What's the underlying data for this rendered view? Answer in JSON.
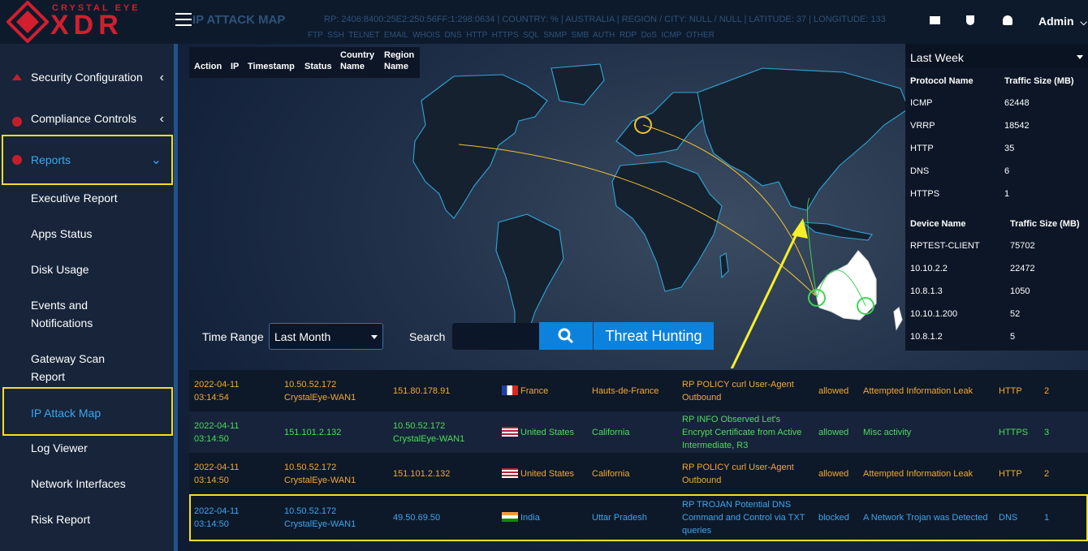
{
  "brand": {
    "name": "CRYSTAL EYE",
    "product": "XDR"
  },
  "header": {
    "title": "IP ATTACK MAP",
    "info": "RP: 2406:8400:25E2:250:56FF:1:298:0634 | COUNTRY: % | AUSTRALIA | REGION / CITY: NULL / NULL | LATITUDE: 37 | LONGITUDE: 133",
    "legend": "FTP  SSH  TELNET  EMAIL  WHOIS  DNS  HTTP  HTTPS  SQL  SNMP  SMB  AUTH  RDP  DoS  ICMP  OTHER",
    "admin": "Admin"
  },
  "sidebar": {
    "security": "Security Configuration",
    "compliance": "Compliance Controls",
    "reports": "Reports",
    "items": [
      "Executive Report",
      "Apps Status",
      "Disk Usage",
      "Events and Notifications",
      "Gateway Scan Report",
      "IP Attack Map",
      "Log Viewer",
      "Network Interfaces",
      "Risk Report"
    ]
  },
  "left_table": {
    "cols": [
      "Action",
      "IP",
      "Timestamp",
      "Status",
      "Country Name",
      "Region Name"
    ]
  },
  "controls": {
    "time_range_label": "Time Range",
    "time_range": "Last Month",
    "search_label": "Search",
    "threat": "Threat Hunting"
  },
  "right_panel": {
    "period": "Last Week",
    "proto_head": [
      "Protocol Name",
      "Traffic Size (MB)"
    ],
    "protocols": [
      [
        "ICMP",
        "62448"
      ],
      [
        "VRRP",
        "18542"
      ],
      [
        "HTTP",
        "35"
      ],
      [
        "DNS",
        "6"
      ],
      [
        "HTTPS",
        "1"
      ]
    ],
    "dev_head": [
      "Device Name",
      "Traffic Size (MB)"
    ],
    "devices": [
      [
        "RPTEST-CLIENT",
        "75702"
      ],
      [
        "10.10.2.2",
        "22472"
      ],
      [
        "10.8.1.3",
        "1050"
      ],
      [
        "10.10.1.200",
        "52"
      ],
      [
        "10.8.1.2",
        "5"
      ]
    ]
  },
  "rows": [
    {
      "date": "2022-04-11",
      "time": "03:14:54",
      "src_ip": "10.50.52.172",
      "src_name": "CrystalEye-WAN1",
      "dst": "151.80.178.91",
      "dst2": "",
      "country": "France",
      "region": "Hauts-de-France",
      "msg": "RP POLICY curl User-Agent Outbound",
      "action": "allowed",
      "class": "Attempted Information Leak",
      "proto": "HTTP",
      "num": "2",
      "color": "#f2a933"
    },
    {
      "date": "2022-04-11",
      "time": "03:14:50",
      "src_ip": "151.101.2.132",
      "src_name": "",
      "dst": "10.50.52.172",
      "dst2": "CrystalEye-WAN1",
      "country": "United States",
      "region": "California",
      "msg": "RP INFO Observed Let's Encrypt Certificate from Active Intermediate, R3",
      "action": "allowed",
      "class": "Misc activity",
      "proto": "HTTPS",
      "num": "3",
      "color": "#4ddc5a"
    },
    {
      "date": "2022-04-11",
      "time": "03:14:50",
      "src_ip": "10.50.52.172",
      "src_name": "CrystalEye-WAN1",
      "dst": "151.101.2.132",
      "dst2": "",
      "country": "United States",
      "region": "California",
      "msg": "RP POLICY curl User-Agent Outbound",
      "action": "allowed",
      "class": "Attempted Information Leak",
      "proto": "HTTP",
      "num": "2",
      "color": "#f2a933"
    },
    {
      "date": "2022-04-11",
      "time": "03:14:50",
      "src_ip": "10.50.52.172",
      "src_name": "CrystalEye-WAN1",
      "dst": "49.50.69.50",
      "dst2": "",
      "country": "India",
      "region": "Uttar Pradesh",
      "msg": "RP TROJAN Potential DNS Command and Control via TXT queries",
      "action": "blocked",
      "class": "A Network Trojan was Detected",
      "proto": "DNS",
      "num": "1",
      "color": "#3aa8ef"
    }
  ]
}
